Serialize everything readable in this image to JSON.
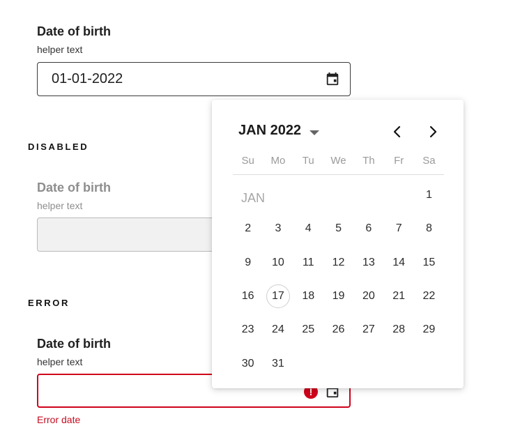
{
  "default": {
    "label": "Date of birth",
    "helper": "helper text",
    "value": "01-01-2022"
  },
  "disabled": {
    "section_title": "DISABLED",
    "label": "Date of birth",
    "helper": "helper text"
  },
  "error": {
    "section_title": "ERROR",
    "label": "Date of birth",
    "helper": "helper text",
    "message": "Error date"
  },
  "calendar": {
    "month_year": "JAN 2022",
    "month_short": "JAN",
    "weekdays": [
      "Su",
      "Mo",
      "Tu",
      "We",
      "Th",
      "Fr",
      "Sa"
    ],
    "first_weekday_index": 6,
    "days": [
      "1",
      "2",
      "3",
      "4",
      "5",
      "6",
      "7",
      "8",
      "9",
      "10",
      "11",
      "12",
      "13",
      "14",
      "15",
      "16",
      "17",
      "18",
      "19",
      "20",
      "21",
      "22",
      "23",
      "24",
      "25",
      "26",
      "27",
      "28",
      "29",
      "30",
      "31"
    ],
    "today": "17",
    "prev_icon": "chevron-left-icon",
    "next_icon": "chevron-right-icon"
  },
  "colors": {
    "error": "#d0021b",
    "border": "#3a3a3a",
    "disabled_bg": "#f1f1f1",
    "muted_text": "#8e8e8e"
  }
}
